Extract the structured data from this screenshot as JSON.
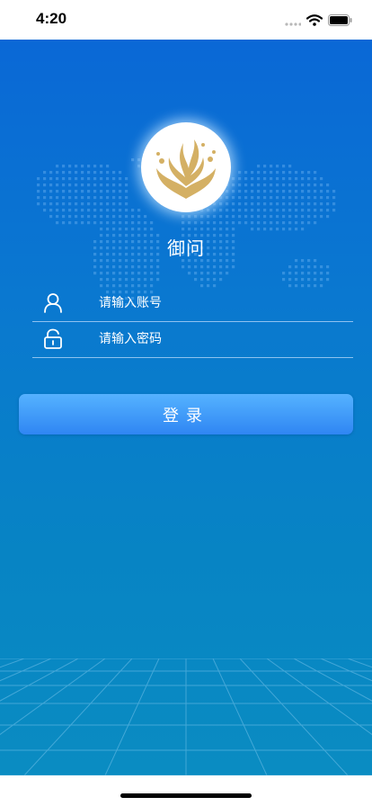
{
  "status_bar": {
    "time": "4:20",
    "icons": [
      "signal-icon",
      "wifi-icon",
      "battery-icon"
    ]
  },
  "app": {
    "name": "御问",
    "logo_icon": "flame-leaf-logo",
    "brand_color": "#d4b064"
  },
  "login": {
    "account_placeholder": "请输入账号",
    "account_value": "",
    "account_icon": "user-icon",
    "password_placeholder": "请输入密码",
    "password_value": "",
    "password_icon": "lock-icon",
    "submit_label": "登录"
  },
  "colors": {
    "background_top": "#0a68d6",
    "background_bottom": "#0a8cc2",
    "button_top": "#55b2ff",
    "button_bottom": "#2f86f3",
    "text": "#ffffff"
  }
}
